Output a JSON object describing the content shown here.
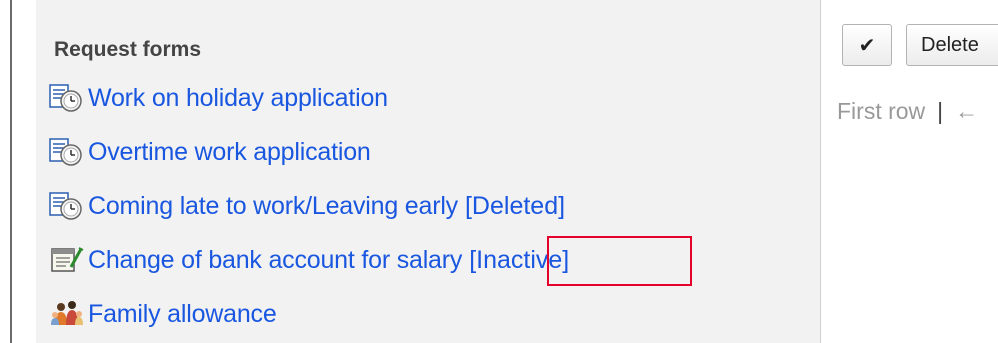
{
  "section": {
    "title": "Request forms"
  },
  "forms": [
    {
      "icon": "clock-form-icon",
      "label": "Work on holiday application",
      "status": ""
    },
    {
      "icon": "clock-form-icon",
      "label": "Overtime work application",
      "status": ""
    },
    {
      "icon": "clock-form-icon",
      "label": "Coming late to work/Leaving early",
      "status": "[Deleted]"
    },
    {
      "icon": "notepad-form-icon",
      "label": "Change of bank account for salary",
      "status": "[Inactive]"
    },
    {
      "icon": "family-form-icon",
      "label": "Family allowance",
      "status": ""
    }
  ],
  "toolbar": {
    "check_glyph": "✔",
    "delete_label": "Delete"
  },
  "pager": {
    "first_row": "First row",
    "separator": "|",
    "next_glyph": "←"
  },
  "colors": {
    "link": "#1a57e0",
    "panel_bg": "#f2f2f2",
    "highlight": "#e3002b",
    "muted_text": "#999999"
  }
}
